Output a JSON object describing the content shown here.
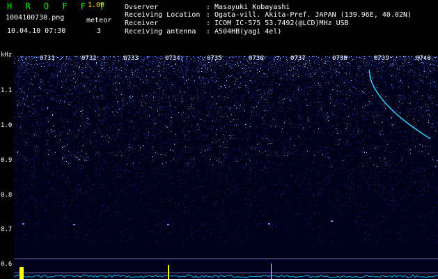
{
  "header": {
    "app_name": "H R O F F T",
    "version": "1.00",
    "filename": "1004100730.png",
    "datetime": "10.04.10 07:30",
    "meteor_label": "meteor",
    "meteor_count": "3"
  },
  "info": [
    {
      "label": "Ovserver",
      "value": ": Masayuki Kobayashi"
    },
    {
      "label": "Receiving Location",
      "value": ": Ogata-vill. Akita-Pref. JAPAN (139.96E, 40.02N)"
    },
    {
      "label": "Receiver",
      "value": ": ICOM IC-575 53.7492(@LCD)MHz USB"
    },
    {
      "label": "Receiving antenna",
      "value": ": A504HB(yagi 4el)"
    }
  ],
  "plot": {
    "y_unit": "kHz",
    "y_ticks": [
      "1.1",
      "1.0",
      "0.9",
      "0.8",
      "0.7",
      "0.6"
    ],
    "time_labels": [
      "0731",
      "0732",
      "0733",
      "0734",
      "0735",
      "0736",
      "0737",
      "0738",
      "0739",
      "0740"
    ],
    "colors": {
      "background": "#000018",
      "noise": "#2030ff",
      "trace": "#30d0ff",
      "spike": "#ffff00",
      "baseline": "#00c0ff"
    }
  }
}
